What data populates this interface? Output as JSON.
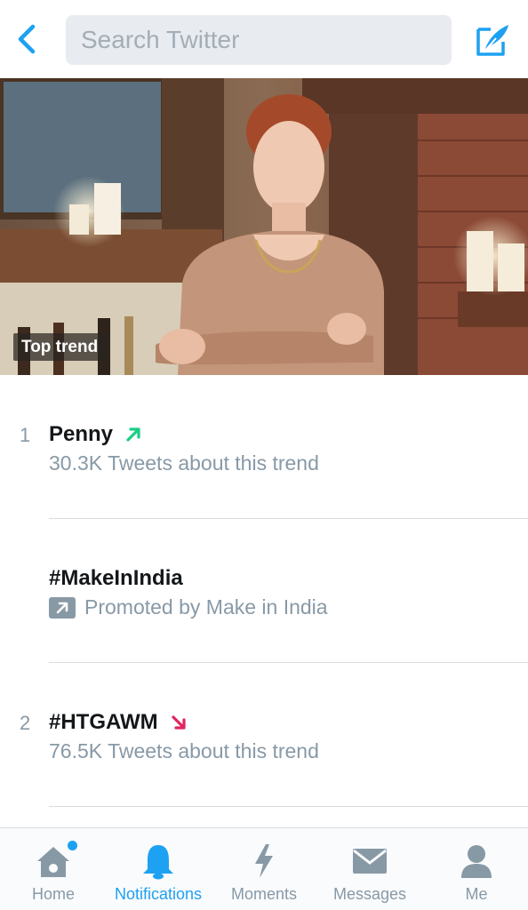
{
  "header": {
    "back_icon": "chevron-left-icon",
    "search_placeholder": "Search Twitter",
    "compose_icon": "compose-tweet-icon",
    "accent_color": "#1da1f2"
  },
  "hero": {
    "badge": "Top trend"
  },
  "trends": [
    {
      "rank": "1",
      "name": "Penny",
      "subtitle": "30.3K Tweets about this trend",
      "direction": "up"
    },
    {
      "rank": "",
      "name": "#MakeInIndia",
      "subtitle": "Promoted by Make in India",
      "direction": "promoted"
    },
    {
      "rank": "2",
      "name": "#HTGAWM",
      "subtitle": "76.5K Tweets about this trend",
      "direction": "down"
    }
  ],
  "colors": {
    "trend_up": "#19cf86",
    "trend_down": "#e0245e",
    "muted": "#8899a6"
  },
  "tabbar": {
    "tabs": [
      {
        "label": "Home",
        "icon": "home-icon",
        "active": false,
        "badge": true
      },
      {
        "label": "Notifications",
        "icon": "bell-icon",
        "active": true
      },
      {
        "label": "Moments",
        "icon": "lightning-icon",
        "active": false
      },
      {
        "label": "Messages",
        "icon": "envelope-icon",
        "active": false
      },
      {
        "label": "Me",
        "icon": "person-icon",
        "active": false
      }
    ]
  }
}
